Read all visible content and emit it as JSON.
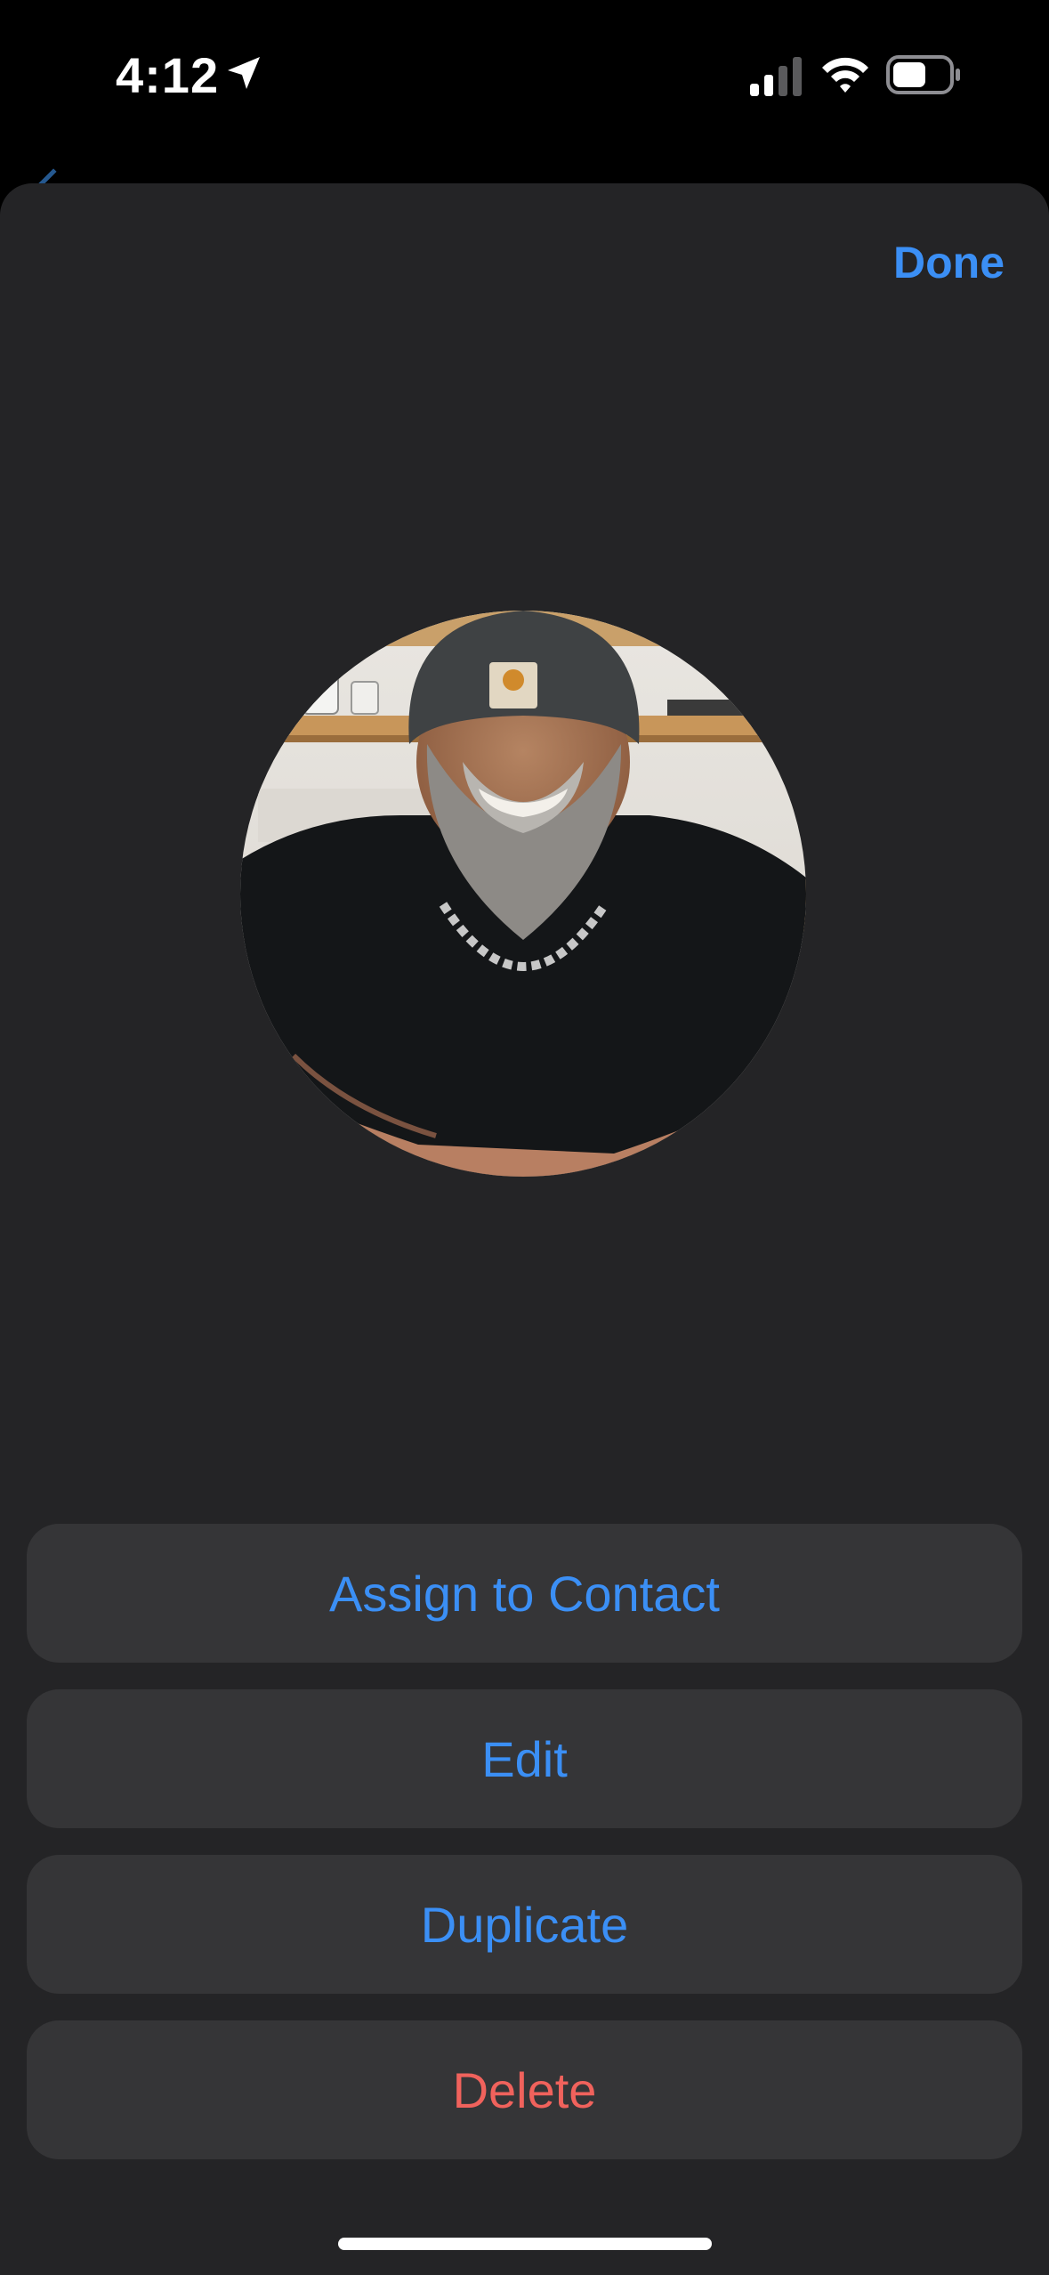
{
  "status_bar": {
    "time": "4:12",
    "icons": [
      "location-arrow-icon",
      "cellular-signal-icon",
      "wifi-icon",
      "battery-icon"
    ]
  },
  "sheet": {
    "done_label": "Done",
    "avatar": {
      "icon": "contact-photo"
    },
    "actions": [
      {
        "label": "Assign to Contact",
        "style": "default"
      },
      {
        "label": "Edit",
        "style": "default"
      },
      {
        "label": "Duplicate",
        "style": "default"
      },
      {
        "label": "Delete",
        "style": "destructive"
      }
    ]
  },
  "colors": {
    "accent": "#3b8ff5",
    "destructive": "#f0625c",
    "sheet_background": "#242426",
    "button_background": "#353537"
  }
}
